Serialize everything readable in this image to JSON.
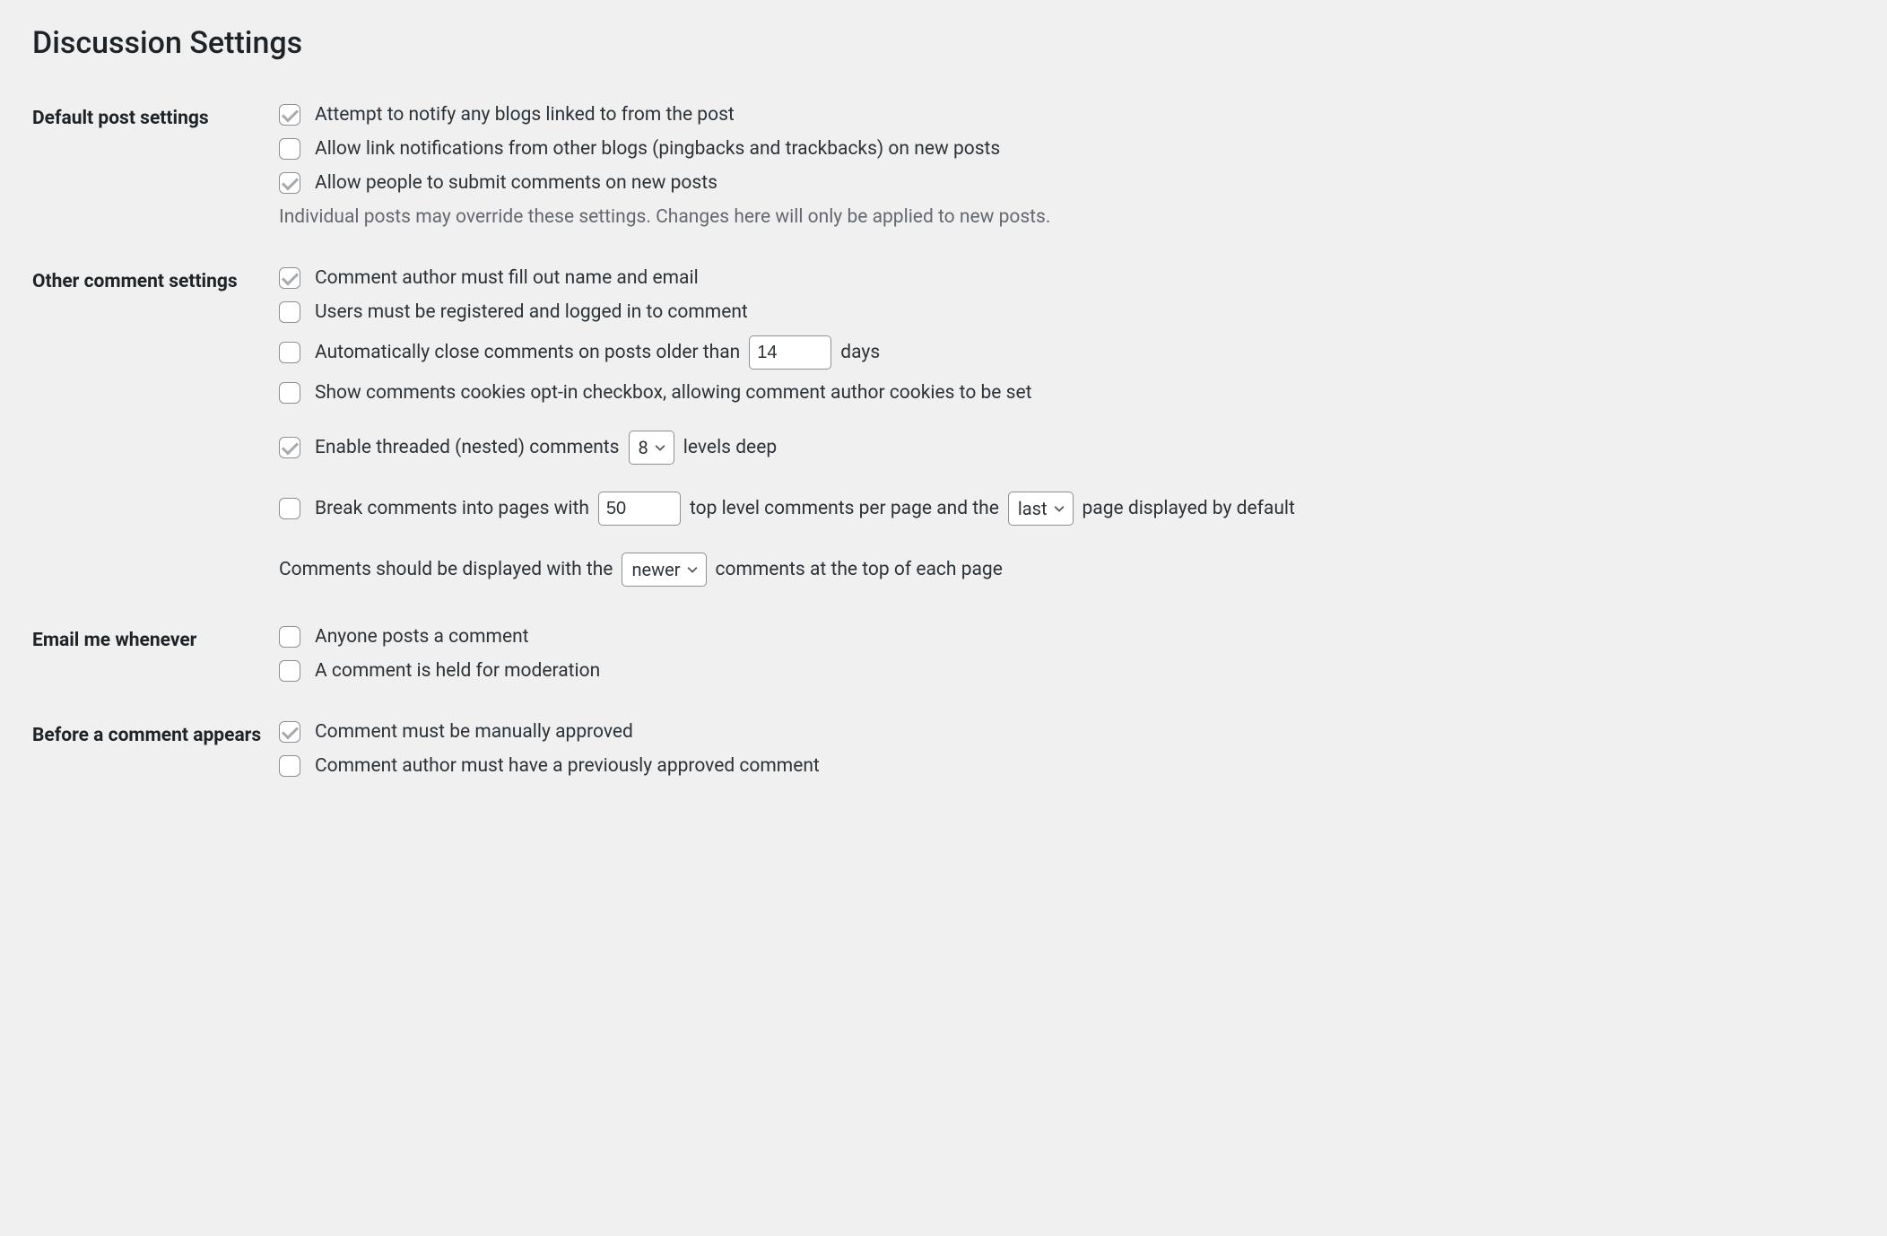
{
  "page_title": "Discussion Settings",
  "sections": {
    "default_post": {
      "heading": "Default post settings",
      "notify_blogs": {
        "label": "Attempt to notify any blogs linked to from the post",
        "checked": true
      },
      "allow_pingbacks": {
        "label": "Allow link notifications from other blogs (pingbacks and trackbacks) on new posts",
        "checked": false
      },
      "allow_comments": {
        "label": "Allow people to submit comments on new posts",
        "checked": true
      },
      "note": "Individual posts may override these settings. Changes here will only be applied to new posts."
    },
    "other_comment": {
      "heading": "Other comment settings",
      "require_name_email": {
        "label": "Comment author must fill out name and email",
        "checked": true
      },
      "require_registration": {
        "label": "Users must be registered and logged in to comment",
        "checked": false
      },
      "auto_close": {
        "checked": false,
        "label_before": "Automatically close comments on posts older than",
        "days_value": "14",
        "label_after": "days"
      },
      "cookies_opt_in": {
        "label": "Show comments cookies opt-in checkbox, allowing comment author cookies to be set",
        "checked": false
      },
      "threaded": {
        "checked": true,
        "label_before": "Enable threaded (nested) comments",
        "depth_value": "8",
        "label_after": "levels deep"
      },
      "pagination": {
        "checked": false,
        "label_1": "Break comments into pages with",
        "per_page_value": "50",
        "label_2": "top level comments per page and the",
        "default_page_value": "last",
        "label_3": "page displayed by default"
      },
      "order": {
        "label_before": "Comments should be displayed with the",
        "order_value": "newer",
        "label_after": "comments at the top of each page"
      }
    },
    "email_me": {
      "heading": "Email me whenever",
      "anyone_posts": {
        "label": "Anyone posts a comment",
        "checked": false
      },
      "held_moderation": {
        "label": "A comment is held for moderation",
        "checked": false
      }
    },
    "before_appears": {
      "heading": "Before a comment appears",
      "manual_approve": {
        "label": "Comment must be manually approved",
        "checked": true
      },
      "prev_approved": {
        "label": "Comment author must have a previously approved comment",
        "checked": false
      }
    }
  }
}
